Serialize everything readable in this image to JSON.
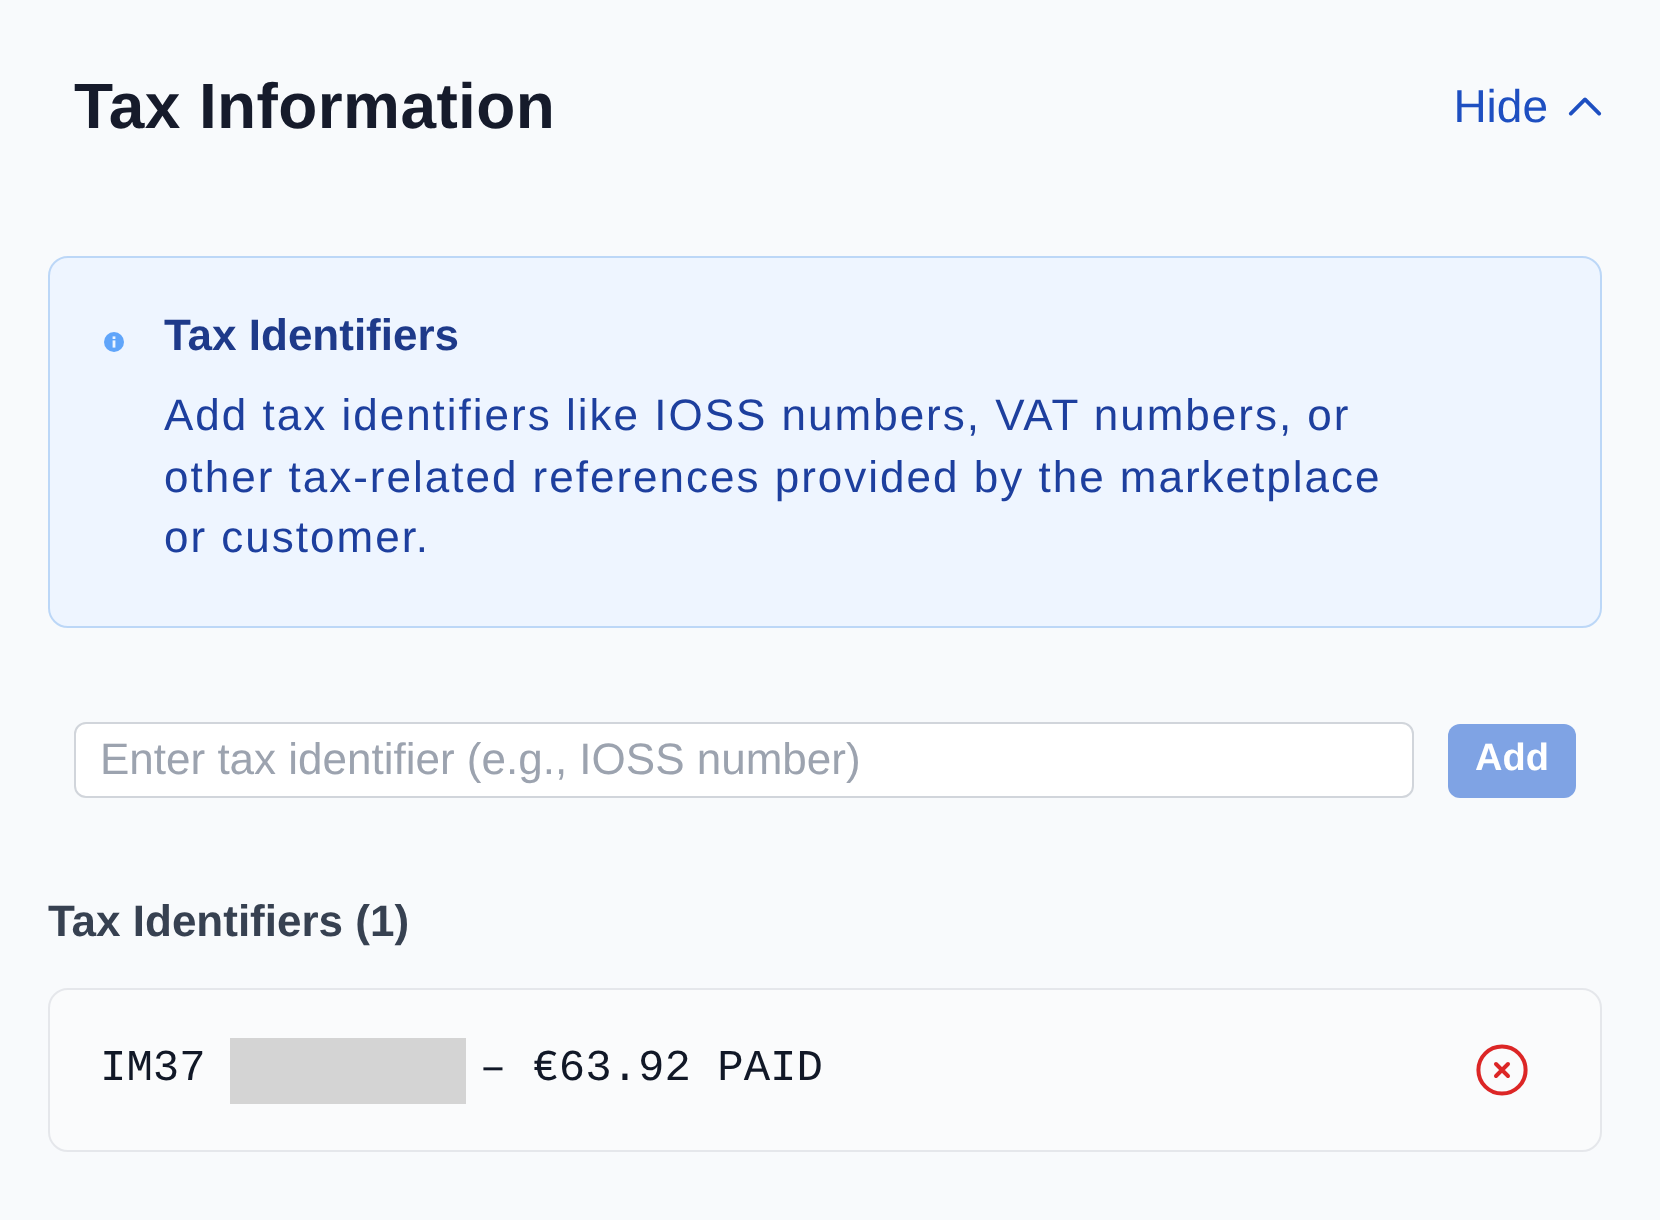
{
  "header": {
    "title": "Tax Information",
    "toggle": {
      "label": "Hide",
      "expanded": true
    }
  },
  "notice": {
    "title": "Tax Identifiers",
    "body": "Add tax identifiers like IOSS numbers, VAT numbers, or other tax-related references provided by the marketplace or customer."
  },
  "entry": {
    "placeholder": "Enter tax identifier (e.g., IOSS number)",
    "button": {
      "label": "Add",
      "disabled": true
    }
  },
  "list": {
    "heading": "Tax Identifiers (1)",
    "items": [
      {
        "parts": [
          {
            "kind": "text",
            "text": "IM37"
          },
          {
            "kind": "redaction"
          },
          {
            "kind": "text",
            "text": "– €63.92 PAID"
          }
        ]
      }
    ]
  }
}
